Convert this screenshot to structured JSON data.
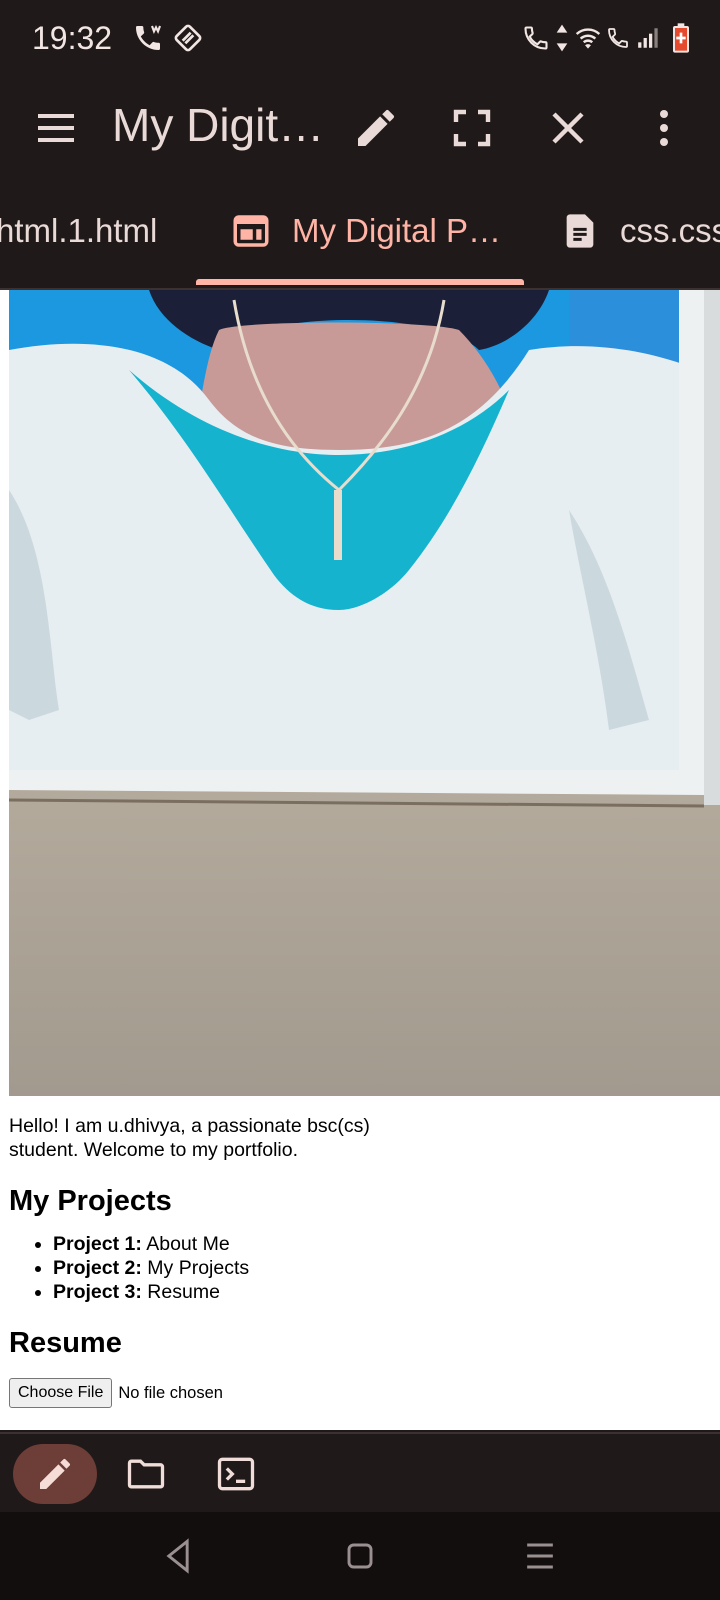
{
  "status_bar": {
    "time": "19:32",
    "left_icons": [
      "wifi-calling-icon",
      "rotate-lock-icon"
    ],
    "right_icons": [
      "call-icon",
      "data-arrows-icon",
      "wifi-icon",
      "wifi-call-icon",
      "signal-icon",
      "battery-charging-icon"
    ]
  },
  "app_bar": {
    "menu_icon": "hamburger-menu-icon",
    "title": "My Digit…",
    "actions": [
      "edit-icon",
      "fullscreen-icon",
      "close-icon",
      "more-vert-icon"
    ]
  },
  "tabs": [
    {
      "label": "html.1.html",
      "icon": "",
      "active": false
    },
    {
      "label": "My Digital P…",
      "icon": "web-preview-icon",
      "active": true
    },
    {
      "label": "css.css",
      "icon": "document-icon",
      "active": false
    }
  ],
  "page": {
    "intro": "Hello! I am u.dhivya, a passionate bsc(cs) student. Welcome to my portfolio.",
    "projects_heading": "My Projects",
    "projects": [
      {
        "label": "Project 1:",
        "name": "About Me"
      },
      {
        "label": "Project 2:",
        "name": "My Projects"
      },
      {
        "label": "Project 3:",
        "name": "Resume"
      }
    ],
    "resume_heading": "Resume",
    "file_button": "Choose File",
    "file_status": "No file chosen"
  },
  "bottom_toolbar": {
    "items": [
      "edit-icon",
      "folder-icon",
      "terminal-icon"
    ],
    "active": "edit-icon"
  },
  "nav_bar": {
    "items": [
      "back-icon",
      "home-icon",
      "recents-icon"
    ]
  },
  "colors": {
    "background": "#1f1a19",
    "accent": "#ffb4a6",
    "active_pill": "#6d3d37",
    "text_light": "#eadad7"
  }
}
